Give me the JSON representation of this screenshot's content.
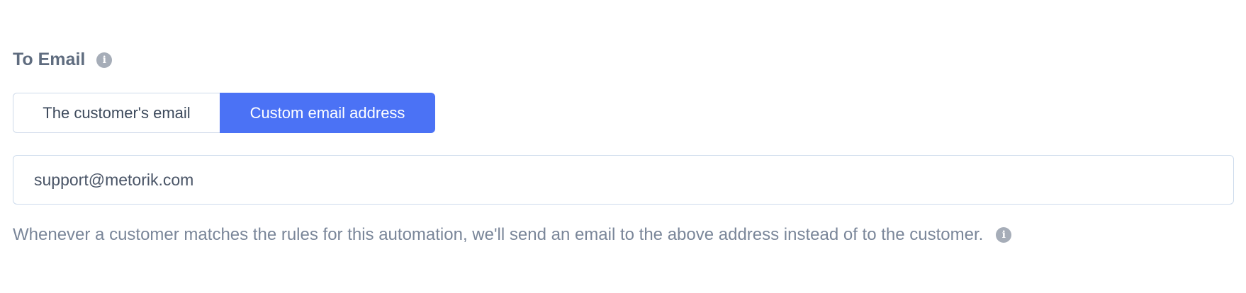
{
  "to_email": {
    "label": "To Email",
    "info_icon": "info-icon"
  },
  "recipient_toggle": {
    "options": [
      {
        "label": "The customer's email",
        "selected": false
      },
      {
        "label": "Custom email address",
        "selected": true
      }
    ]
  },
  "email_field": {
    "value": "support@metorik.com"
  },
  "help": {
    "text": "Whenever a customer matches the rules for this automation, we'll send an email to the above address instead of to the customer.",
    "info_icon": "info-icon"
  },
  "colors": {
    "accent": "#4b72f5",
    "label": "#5f6c7f",
    "help_text": "#7a8699",
    "border": "#cfdaea"
  }
}
